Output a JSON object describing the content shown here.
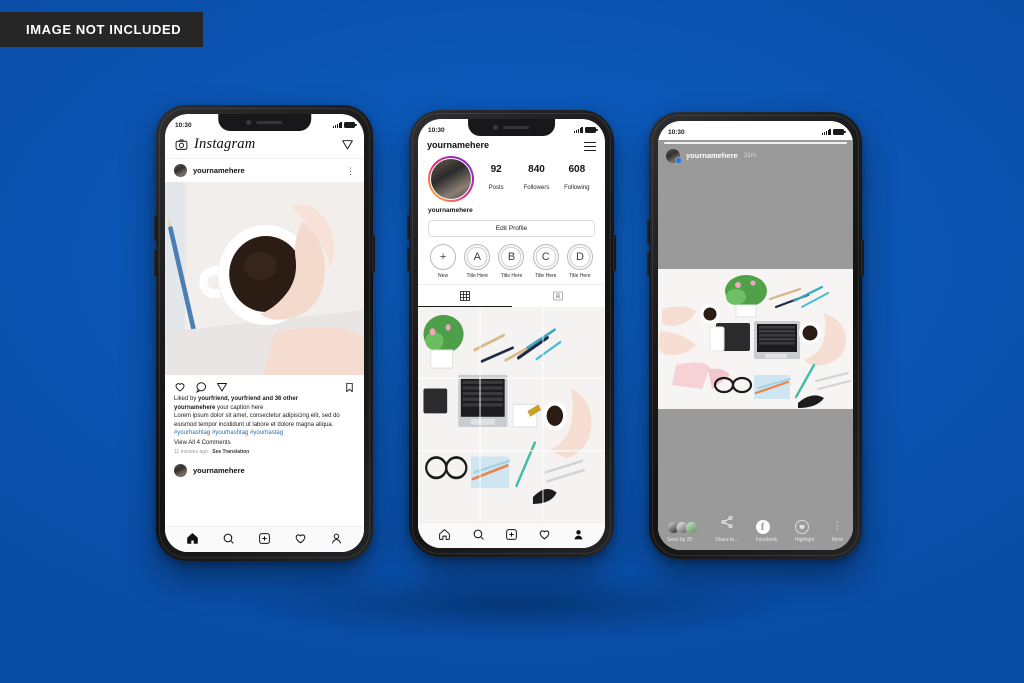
{
  "badge": {
    "label": "IMAGE NOT INCLUDED"
  },
  "theme": {
    "background": "#0b56b6",
    "phone_body": "#1b1b1d",
    "accent_blue": "#2d6fa8",
    "story_bg": "#9a9a9a"
  },
  "phones": [
    {
      "id": "feed",
      "status": {
        "time": "10:30"
      },
      "topbar": {
        "logo_icon": "camera-icon",
        "wordmark": "Instagram",
        "send_icon": "direct-message-icon"
      },
      "post": {
        "username": "yournamehere",
        "menu_icon": "more-options-icon",
        "actions": [
          "heart-icon",
          "comment-icon",
          "share-icon",
          "bookmark-icon"
        ],
        "likes_line_prefix": "Liked by ",
        "likes_names": "yourfriend, yourfriend",
        "likes_line_suffix": " and 36 other",
        "caption_user": "yournamehere",
        "caption_text": " your caption here",
        "caption_body": "Lorem ipsum dolor sit amet, consectetur adipiscing elit, sed do eiusmod tempor incididunt ut labore et dolore magna aliqua.",
        "hashtags": "#yourhashtag #yourhashtag #yourhastag",
        "comments_link": "View All 4 Comments",
        "timestamp": "11 minutes ago ·",
        "translate": "See Translation",
        "footer_username": "yournamehere"
      },
      "tabbar": [
        "home-icon",
        "search-icon",
        "add-post-icon",
        "activity-icon",
        "profile-icon"
      ]
    },
    {
      "id": "profile",
      "status": {
        "time": "10:30"
      },
      "header": {
        "username": "yournamehere",
        "menu_icon": "hamburger-menu-icon"
      },
      "stats": [
        {
          "number": "92",
          "label": "Posts"
        },
        {
          "number": "840",
          "label": "Followers"
        },
        {
          "number": "608",
          "label": "Following"
        }
      ],
      "handle": "yournamehere",
      "edit_button": "Edit Profile",
      "highlights": [
        {
          "glyph": "+",
          "title": "New"
        },
        {
          "glyph": "A",
          "title": "Title Here"
        },
        {
          "glyph": "B",
          "title": "Title Here"
        },
        {
          "glyph": "C",
          "title": "Title Here"
        },
        {
          "glyph": "D",
          "title": "Title Here"
        }
      ],
      "tabs": [
        {
          "icon": "grid-icon",
          "active": true
        },
        {
          "icon": "tagged-icon",
          "active": false
        }
      ],
      "tabbar": [
        "home-icon",
        "search-icon",
        "add-post-icon",
        "activity-icon",
        "profile-icon"
      ]
    },
    {
      "id": "story",
      "status": {
        "time": "10:30"
      },
      "header": {
        "username": "yournamehere",
        "time_ago": "31m",
        "badge_icon": "facebook-badge-icon"
      },
      "footer": {
        "seen_label": "Seen by 25",
        "actions": [
          {
            "icon": "share-icon",
            "label": "Share to..."
          },
          {
            "icon": "facebook-icon",
            "label": "Facebook"
          },
          {
            "icon": "highlight-icon",
            "label": "Highlight"
          },
          {
            "icon": "more-icon",
            "label": "More"
          }
        ]
      }
    }
  ]
}
